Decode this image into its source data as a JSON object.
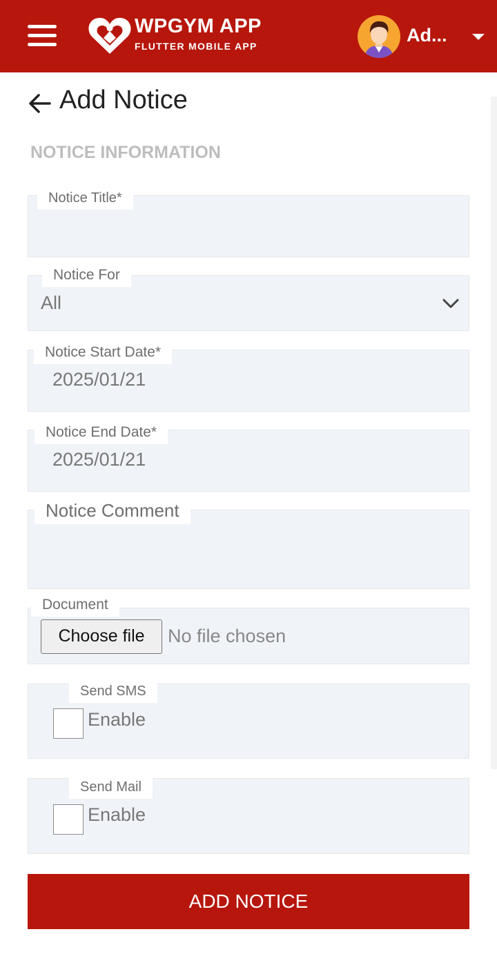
{
  "header": {
    "menu_icon": "hamburger-menu-icon",
    "logo_icon": "heart-logo-icon",
    "app_title": "WPGYM APP",
    "app_subtitle": "FLUTTER MOBILE APP",
    "avatar_icon": "user-avatar-icon",
    "user_name": "Ad...",
    "dropdown_icon": "caret-down-icon",
    "brand_color": "#b7160c"
  },
  "page": {
    "back_icon": "arrow-left-icon",
    "title": "Add Notice",
    "section_title": "NOTICE INFORMATION"
  },
  "form": {
    "notice_title": {
      "label": "Notice Title*",
      "value": ""
    },
    "notice_for": {
      "label": "Notice For",
      "value": "All",
      "icon": "chevron-down-icon"
    },
    "start_date": {
      "label": "Notice Start Date*",
      "value": "2025/01/21"
    },
    "end_date": {
      "label": "Notice End Date*",
      "value": "2025/01/21"
    },
    "comment": {
      "label": "Notice Comment",
      "value": ""
    },
    "document": {
      "label": "Document",
      "button_label": "Choose file",
      "status": "No file chosen"
    },
    "send_sms": {
      "label": "Send SMS",
      "option": "Enable",
      "checked": false
    },
    "send_mail": {
      "label": "Send Mail",
      "option": "Enable",
      "checked": false
    },
    "submit_label": "ADD NOTICE"
  }
}
